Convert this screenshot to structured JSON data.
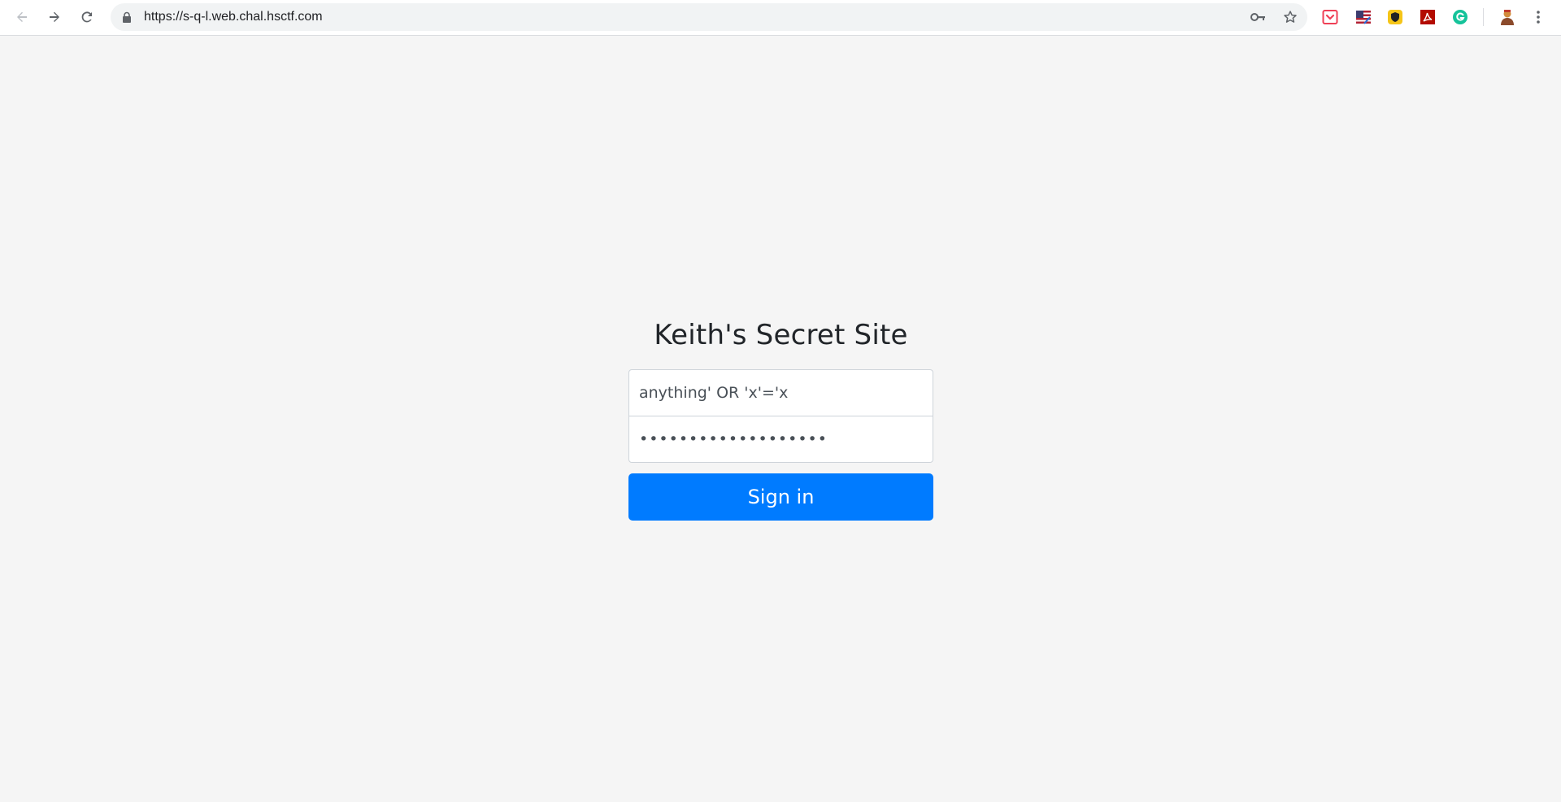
{
  "browser": {
    "url": "https://s-q-l.web.chal.hsctf.com",
    "nav_icons": [
      "back-arrow-icon",
      "forward-arrow-icon",
      "reload-icon"
    ],
    "omnibox_icons": [
      "lock-icon",
      "key-icon",
      "star-icon"
    ],
    "extensions": [
      {
        "name": "pocket-icon",
        "color": "#ef4056"
      },
      {
        "name": "flag-icon",
        "color": "#3c3b6e"
      },
      {
        "name": "shield-icon",
        "color": "#f5c518"
      },
      {
        "name": "pdf-icon",
        "color": "#b30b00"
      },
      {
        "name": "grammarly-icon",
        "color": "#15c39a"
      }
    ],
    "profile_icon": "avatar",
    "menu_icon": "kebab-menu-icon"
  },
  "page": {
    "title": "Keith's Secret Site",
    "username": {
      "value": "anything' OR 'x'='x"
    },
    "password": {
      "value": "•••••••••••••••••••"
    },
    "submit_label": "Sign in",
    "accent_color": "#007bff",
    "background_color": "#f5f5f5"
  }
}
